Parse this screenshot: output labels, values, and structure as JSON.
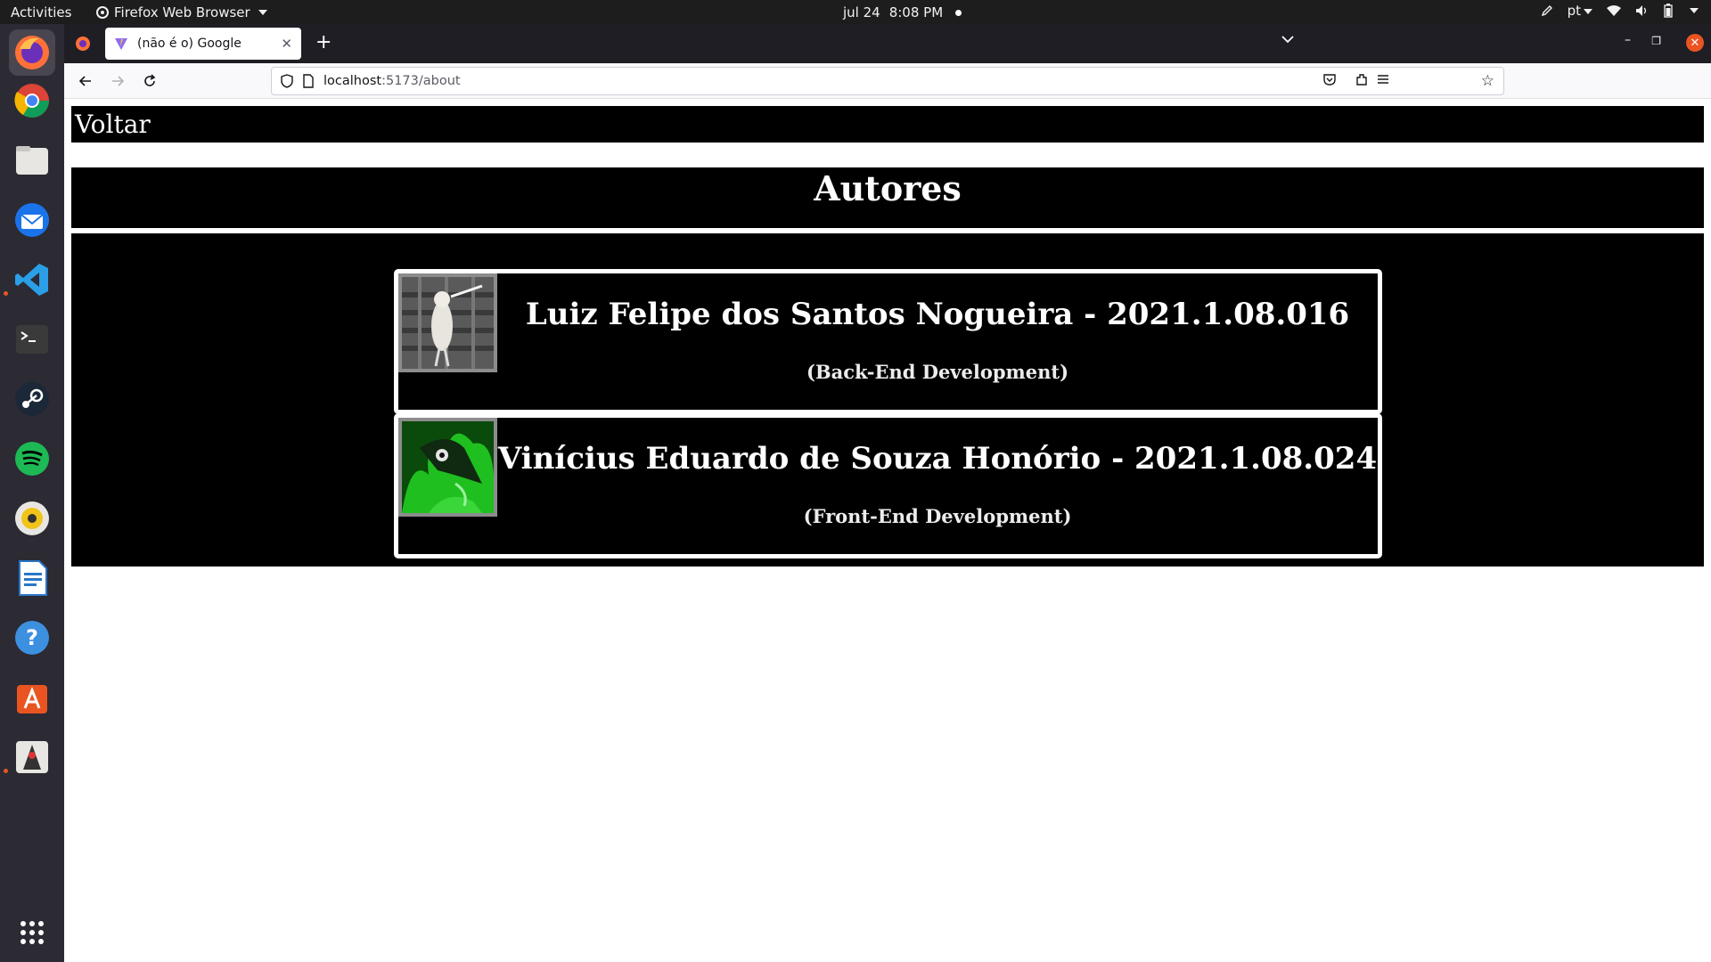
{
  "system_bar": {
    "activities": "Activities",
    "app_name": "Firefox Web Browser",
    "date": "jul 24",
    "time": "8:08 PM",
    "language": "pt"
  },
  "dock": {
    "apps": [
      "firefox",
      "chrome",
      "files",
      "thunderbird",
      "vscode",
      "terminal",
      "steam",
      "spotify",
      "rhythmbox",
      "libreoffice-writer",
      "help",
      "app-center",
      "java"
    ],
    "show_apps_icon": "grid-icon"
  },
  "browser": {
    "tab_title": "(não é o) Google",
    "url_host": "localhost",
    "url_rest": ":5173/about"
  },
  "page": {
    "back_link": "Voltar",
    "heading": "Autores",
    "authors": [
      {
        "name": "Luiz Felipe dos Santos Nogueira - 2021.1.08.016",
        "role": "(Back-End Development)",
        "photo": "rat-photo"
      },
      {
        "name": "Vinícius Eduardo de Souza Honório - 2021.1.08.024",
        "role": "(Front-End Development)",
        "photo": "plague-doctor-avatar"
      }
    ]
  },
  "colors": {
    "page_bg": "#ffffff",
    "panel_bg": "#000000",
    "text": "#ffffff",
    "ubuntu_orange": "#e95420"
  }
}
